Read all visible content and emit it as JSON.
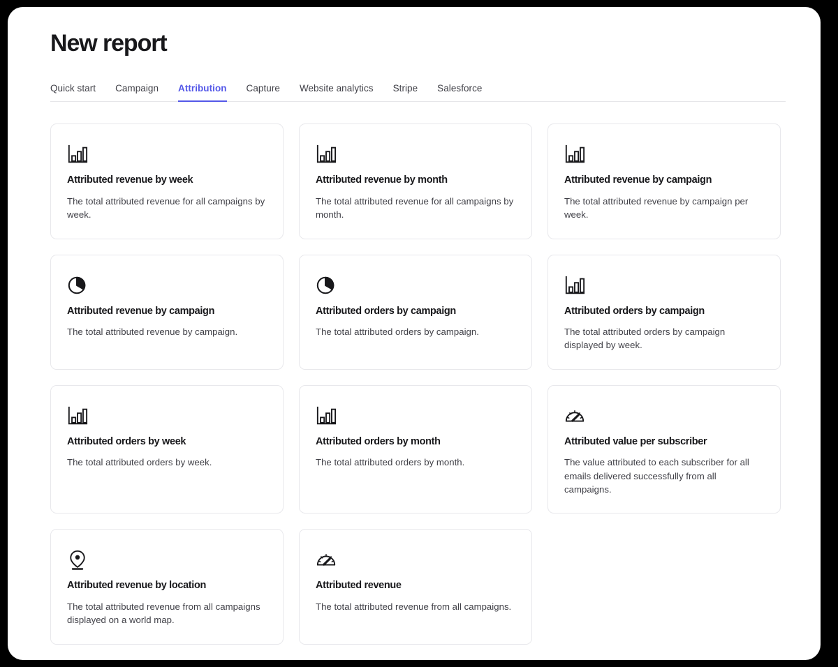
{
  "header": {
    "title": "New report"
  },
  "tabs": [
    {
      "label": "Quick start",
      "active": false
    },
    {
      "label": "Campaign",
      "active": false
    },
    {
      "label": "Attribution",
      "active": true
    },
    {
      "label": "Capture",
      "active": false
    },
    {
      "label": "Website analytics",
      "active": false
    },
    {
      "label": "Stripe",
      "active": false
    },
    {
      "label": "Salesforce",
      "active": false
    }
  ],
  "accent_color": "#5458e8",
  "cards": [
    {
      "icon": "bar-chart-icon",
      "title": "Attributed revenue by week",
      "description": "The total attributed revenue for all campaigns by week."
    },
    {
      "icon": "bar-chart-icon",
      "title": "Attributed revenue by month",
      "description": "The total attributed revenue for all campaigns by month."
    },
    {
      "icon": "bar-chart-icon",
      "title": "Attributed revenue by campaign",
      "description": "The total attributed revenue by campaign per week."
    },
    {
      "icon": "pie-chart-icon",
      "title": "Attributed revenue by campaign",
      "description": "The total attributed revenue by campaign."
    },
    {
      "icon": "pie-chart-icon",
      "title": "Attributed orders by campaign",
      "description": "The total attributed orders by campaign."
    },
    {
      "icon": "bar-chart-icon",
      "title": "Attributed orders by campaign",
      "description": "The total attributed orders by campaign displayed by week."
    },
    {
      "icon": "bar-chart-icon",
      "title": "Attributed orders by week",
      "description": "The total attributed orders by week."
    },
    {
      "icon": "bar-chart-icon",
      "title": "Attributed orders by month",
      "description": "The total attributed orders by month."
    },
    {
      "icon": "gauge-icon",
      "title": "Attributed value per subscriber",
      "description": "The value attributed to each subscriber for all emails delivered successfully from all campaigns."
    },
    {
      "icon": "map-pin-icon",
      "title": "Attributed revenue by location",
      "description": "The total attributed revenue from all campaigns displayed on a world map."
    },
    {
      "icon": "gauge-icon",
      "title": "Attributed revenue",
      "description": "The total attributed revenue from all campaigns."
    }
  ]
}
